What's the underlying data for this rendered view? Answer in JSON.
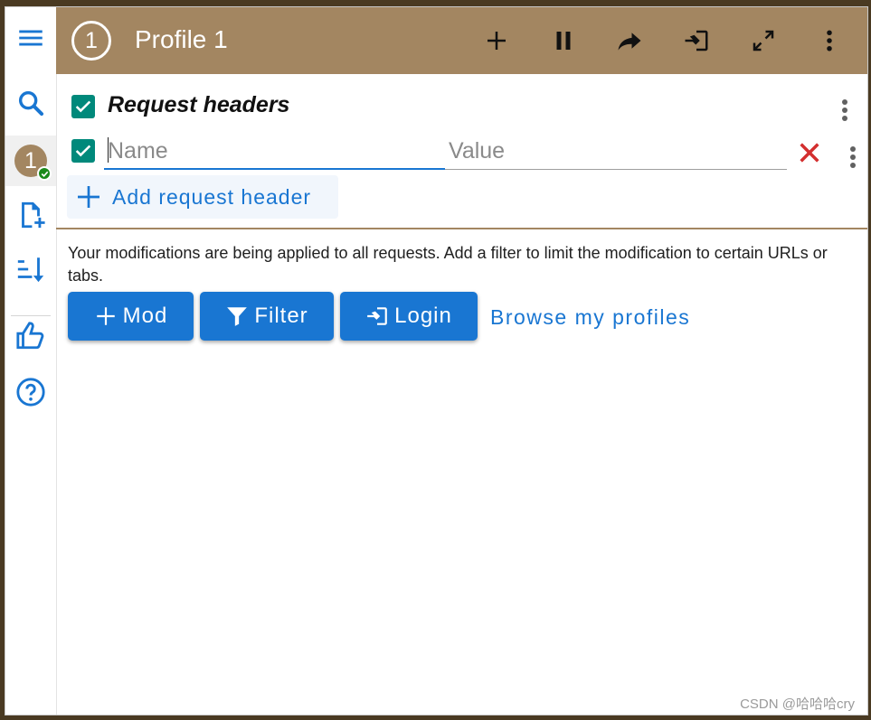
{
  "colors": {
    "accent": "#a38661",
    "primary": "#1976d2",
    "checkbox": "#00897b",
    "danger": "#d32f2f",
    "success": "#1b8a1b"
  },
  "sidebar": {
    "items": [
      {
        "name": "menu",
        "icon": "hamburger-menu-icon"
      },
      {
        "name": "search",
        "icon": "search-icon"
      },
      {
        "name": "profile",
        "label": "1",
        "icon": "check-badge-icon"
      },
      {
        "name": "add-file",
        "icon": "file-plus-icon"
      },
      {
        "name": "sort",
        "icon": "sort-icon"
      },
      {
        "name": "like",
        "icon": "thumbs-up-icon"
      },
      {
        "name": "help",
        "icon": "help-circle-icon"
      }
    ]
  },
  "header": {
    "profile_number": "1",
    "title": "Profile 1",
    "actions": [
      {
        "name": "add",
        "icon": "plus-icon"
      },
      {
        "name": "pause",
        "icon": "pause-icon"
      },
      {
        "name": "share",
        "icon": "share-icon"
      },
      {
        "name": "login",
        "icon": "login-icon"
      },
      {
        "name": "expand",
        "icon": "expand-icon"
      },
      {
        "name": "more",
        "icon": "more-vert-icon"
      }
    ]
  },
  "request_headers": {
    "title": "Request headers",
    "enabled": true,
    "rows": [
      {
        "enabled": true,
        "name_value": "",
        "name_placeholder": "Name",
        "value_value": "",
        "value_placeholder": "Value"
      }
    ],
    "add_label": "Add request header"
  },
  "info": {
    "text": "Your modifications are being applied to all requests. Add a filter to limit the modification to certain URLs or tabs."
  },
  "actions": {
    "mod_label": "Mod",
    "filter_label": "Filter",
    "login_label": "Login",
    "browse_label": "Browse my profiles"
  },
  "watermark": "CSDN @哈哈哈cry"
}
